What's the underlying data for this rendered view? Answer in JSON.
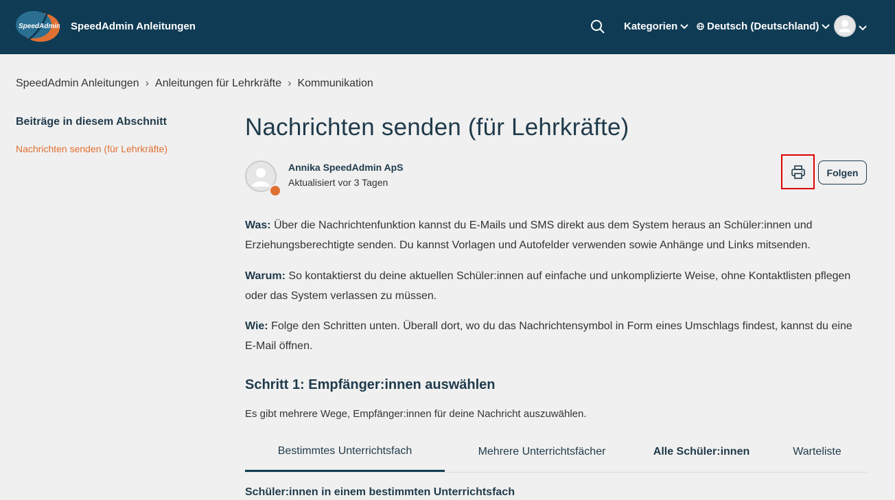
{
  "header": {
    "logo_text": "SpeedAdmin",
    "brand_name": "SpeedAdmin Anleitungen",
    "categories_label": "Kategorien",
    "language_label": "Deutsch (Deutschland)"
  },
  "breadcrumb": [
    "SpeedAdmin Anleitungen",
    "Anleitungen für Lehrkräfte",
    "Kommunikation"
  ],
  "sidebar": {
    "title": "Beiträge in diesem Abschnitt",
    "active_article": "Nachrichten senden (für Lehrkräfte)"
  },
  "article": {
    "title": "Nachrichten senden (für Lehrkräfte)",
    "author": "Annika SpeedAdmin ApS",
    "updated": "Aktualisiert vor 3 Tagen",
    "follow_label": "Folgen",
    "paragraphs": [
      {
        "label": "Was:",
        "text": " Über die Nachrichtenfunktion kannst du E-Mails und SMS direkt aus dem System heraus an Schüler:innen und Erziehungsberechtigte senden. Du kannst Vorlagen und Autofelder verwenden sowie Anhänge und Links mitsenden."
      },
      {
        "label": "Warum:",
        "text": " So kontaktierst du deine aktuellen Schüler:innen auf einfache und unkomplizierte Weise, ohne Kontaktlisten pflegen oder das System verlassen zu müssen."
      },
      {
        "label": "Wie:",
        "text": " Folge den Schritten unten. Überall dort, wo du das Nachrichtensymbol in Form eines Umschlags findest, kannst du eine E-Mail öffnen."
      }
    ],
    "step1_heading": "Schritt 1: Empfänger:innen auswählen",
    "step1_intro": "Es gibt mehrere Wege, Empfänger:innen für deine Nachricht auszuwählen.",
    "tabs": [
      "Bestimmtes Unterrichtsfach",
      "Mehrere Unterrichtsfächer",
      "Alle Schüler:innen",
      "Warteliste"
    ],
    "active_tab": "Bestimmtes Unterrichtsfach",
    "subheading": "Schüler:innen in einem bestimmten Unterrichtsfach"
  },
  "colors": {
    "header_bg": "#0f3b54",
    "accent": "#e07032",
    "highlight_box": "#e00000"
  }
}
